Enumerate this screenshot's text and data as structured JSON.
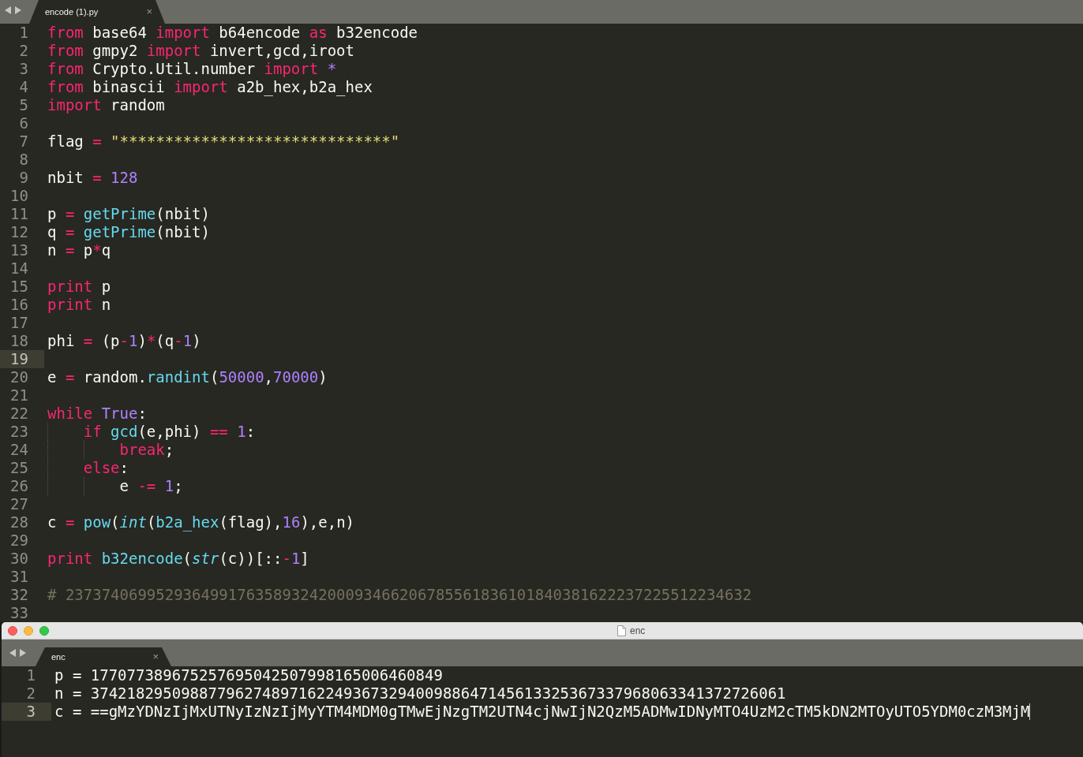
{
  "top_editor": {
    "tab": {
      "title": "encode (1).py",
      "close": "×",
      "selected": true
    },
    "lines": [
      {
        "number": "1",
        "current": false,
        "tokens": [
          {
            "kind": "kw",
            "text": "from"
          },
          {
            "kind": "id",
            "text": " base64 "
          },
          {
            "kind": "kw",
            "text": "import"
          },
          {
            "kind": "id",
            "text": " b64encode "
          },
          {
            "kind": "kw",
            "text": "as"
          },
          {
            "kind": "id",
            "text": " b32encode"
          }
        ]
      },
      {
        "number": "2",
        "current": false,
        "tokens": [
          {
            "kind": "kw",
            "text": "from"
          },
          {
            "kind": "id",
            "text": " gmpy2 "
          },
          {
            "kind": "kw",
            "text": "import"
          },
          {
            "kind": "id",
            "text": " invert,gcd,iroot"
          }
        ]
      },
      {
        "number": "3",
        "current": false,
        "tokens": [
          {
            "kind": "kw",
            "text": "from"
          },
          {
            "kind": "id",
            "text": " Crypto.Util.number "
          },
          {
            "kind": "kw",
            "text": "import"
          },
          {
            "kind": "num",
            "text": " *"
          }
        ]
      },
      {
        "number": "4",
        "current": false,
        "tokens": [
          {
            "kind": "kw",
            "text": "from"
          },
          {
            "kind": "id",
            "text": " binascii "
          },
          {
            "kind": "kw",
            "text": "import"
          },
          {
            "kind": "id",
            "text": " a2b_hex,b2a_hex"
          }
        ]
      },
      {
        "number": "5",
        "current": false,
        "tokens": [
          {
            "kind": "kw",
            "text": "import"
          },
          {
            "kind": "id",
            "text": " random"
          }
        ]
      },
      {
        "number": "6",
        "current": false
      },
      {
        "number": "7",
        "current": false,
        "tokens": [
          {
            "kind": "id",
            "text": "flag "
          },
          {
            "kind": "op",
            "text": "="
          },
          {
            "kind": "str",
            "text": " \"******************************\""
          }
        ]
      },
      {
        "number": "8",
        "current": false
      },
      {
        "number": "9",
        "current": false,
        "tokens": [
          {
            "kind": "id",
            "text": "nbit "
          },
          {
            "kind": "op",
            "text": "="
          },
          {
            "kind": "num",
            "text": " 128"
          }
        ]
      },
      {
        "number": "10",
        "current": false
      },
      {
        "number": "11",
        "current": false,
        "tokens": [
          {
            "kind": "id",
            "text": "p "
          },
          {
            "kind": "op",
            "text": "="
          },
          {
            "kind": "fn",
            "text": " getPrime"
          },
          {
            "kind": "id",
            "text": "(nbit)"
          }
        ]
      },
      {
        "number": "12",
        "current": false,
        "tokens": [
          {
            "kind": "id",
            "text": "q "
          },
          {
            "kind": "op",
            "text": "="
          },
          {
            "kind": "fn",
            "text": " getPrime"
          },
          {
            "kind": "id",
            "text": "(nbit)"
          }
        ]
      },
      {
        "number": "13",
        "current": false,
        "tokens": [
          {
            "kind": "id",
            "text": "n "
          },
          {
            "kind": "op",
            "text": "="
          },
          {
            "kind": "id",
            "text": " p"
          },
          {
            "kind": "op",
            "text": "*"
          },
          {
            "kind": "id",
            "text": "q"
          }
        ]
      },
      {
        "number": "14",
        "current": false
      },
      {
        "number": "15",
        "current": false,
        "tokens": [
          {
            "kind": "kw",
            "text": "print"
          },
          {
            "kind": "id",
            "text": " p"
          }
        ]
      },
      {
        "number": "16",
        "current": false,
        "tokens": [
          {
            "kind": "kw",
            "text": "print"
          },
          {
            "kind": "id",
            "text": " n"
          }
        ]
      },
      {
        "number": "17",
        "current": false
      },
      {
        "number": "18",
        "current": false,
        "tokens": [
          {
            "kind": "id",
            "text": "phi "
          },
          {
            "kind": "op",
            "text": "="
          },
          {
            "kind": "id",
            "text": " (p"
          },
          {
            "kind": "op",
            "text": "-"
          },
          {
            "kind": "num",
            "text": "1"
          },
          {
            "kind": "id",
            "text": ")"
          },
          {
            "kind": "op",
            "text": "*"
          },
          {
            "kind": "id",
            "text": "(q"
          },
          {
            "kind": "op",
            "text": "-"
          },
          {
            "kind": "num",
            "text": "1"
          },
          {
            "kind": "id",
            "text": ")"
          }
        ]
      },
      {
        "number": "19",
        "current": true
      },
      {
        "number": "20",
        "current": false,
        "tokens": [
          {
            "kind": "id",
            "text": "e "
          },
          {
            "kind": "op",
            "text": "="
          },
          {
            "kind": "id",
            "text": " random."
          },
          {
            "kind": "fn",
            "text": "randint"
          },
          {
            "kind": "id",
            "text": "("
          },
          {
            "kind": "num",
            "text": "50000"
          },
          {
            "kind": "id",
            "text": ","
          },
          {
            "kind": "num",
            "text": "70000"
          },
          {
            "kind": "id",
            "text": ")"
          }
        ]
      },
      {
        "number": "21",
        "current": false
      },
      {
        "number": "22",
        "current": false,
        "tokens": [
          {
            "kind": "kw",
            "text": "while"
          },
          {
            "kind": "num",
            "text": " True"
          },
          {
            "kind": "id",
            "text": ":"
          }
        ]
      },
      {
        "number": "23",
        "current": false,
        "tokens": [
          {
            "kind": "indent"
          },
          {
            "kind": "kw",
            "text": "if"
          },
          {
            "kind": "fn",
            "text": " gcd"
          },
          {
            "kind": "id",
            "text": "(e,phi) "
          },
          {
            "kind": "op",
            "text": "=="
          },
          {
            "kind": "num",
            "text": " 1"
          },
          {
            "kind": "id",
            "text": ":"
          }
        ]
      },
      {
        "number": "24",
        "current": false,
        "tokens": [
          {
            "kind": "indent"
          },
          {
            "kind": "indent"
          },
          {
            "kind": "kw",
            "text": "break"
          },
          {
            "kind": "id",
            "text": ";"
          }
        ]
      },
      {
        "number": "25",
        "current": false,
        "tokens": [
          {
            "kind": "indent"
          },
          {
            "kind": "kw",
            "text": "else"
          },
          {
            "kind": "id",
            "text": ":"
          }
        ]
      },
      {
        "number": "26",
        "current": false,
        "tokens": [
          {
            "kind": "indent"
          },
          {
            "kind": "indent"
          },
          {
            "kind": "id",
            "text": "e "
          },
          {
            "kind": "op",
            "text": "-="
          },
          {
            "kind": "num",
            "text": " 1"
          },
          {
            "kind": "id",
            "text": ";"
          }
        ]
      },
      {
        "number": "27",
        "current": false
      },
      {
        "number": "28",
        "current": false,
        "tokens": [
          {
            "kind": "id",
            "text": "c "
          },
          {
            "kind": "op",
            "text": "="
          },
          {
            "kind": "fn",
            "text": " pow"
          },
          {
            "kind": "id",
            "text": "("
          },
          {
            "kind": "type",
            "text": "int"
          },
          {
            "kind": "id",
            "text": "("
          },
          {
            "kind": "fn",
            "text": "b2a_hex"
          },
          {
            "kind": "id",
            "text": "(flag),"
          },
          {
            "kind": "num",
            "text": "16"
          },
          {
            "kind": "id",
            "text": "),e,n)"
          }
        ]
      },
      {
        "number": "29",
        "current": false
      },
      {
        "number": "30",
        "current": false,
        "tokens": [
          {
            "kind": "kw",
            "text": "print"
          },
          {
            "kind": "fn",
            "text": " b32encode"
          },
          {
            "kind": "id",
            "text": "("
          },
          {
            "kind": "type",
            "text": "str"
          },
          {
            "kind": "id",
            "text": "(c))[::"
          },
          {
            "kind": "op",
            "text": "-"
          },
          {
            "kind": "num",
            "text": "1"
          },
          {
            "kind": "id",
            "text": "]"
          }
        ]
      },
      {
        "number": "31",
        "current": false
      },
      {
        "number": "32",
        "current": false,
        "tokens": [
          {
            "kind": "comment",
            "text": "# 2373740699529364991763589324200093466206785561836101840381622237225512234632"
          }
        ]
      },
      {
        "number": "33",
        "current": false
      }
    ]
  },
  "bottom_window": {
    "title": "enc",
    "tab": {
      "title": "enc",
      "close": "×",
      "selected": true
    },
    "lines": [
      {
        "number": "1",
        "current": false,
        "text": "p = 177077389675257695042507998165006460849"
      },
      {
        "number": "2",
        "current": false,
        "text": "n = 37421829509887796274897162249367329400988647145613325367337968063341372726061"
      },
      {
        "number": "3",
        "current": true,
        "text": "c = ==gMzYDNzIjMxUTNyIzNzIjMyYTM4MDM0gTMwEjNzgTM2UTN4cjNwIjN2QzM5ADMwIDNyMTO4UzM2cTM5kDN2MTOyUTO5YDM0czM3MjM"
      }
    ]
  }
}
